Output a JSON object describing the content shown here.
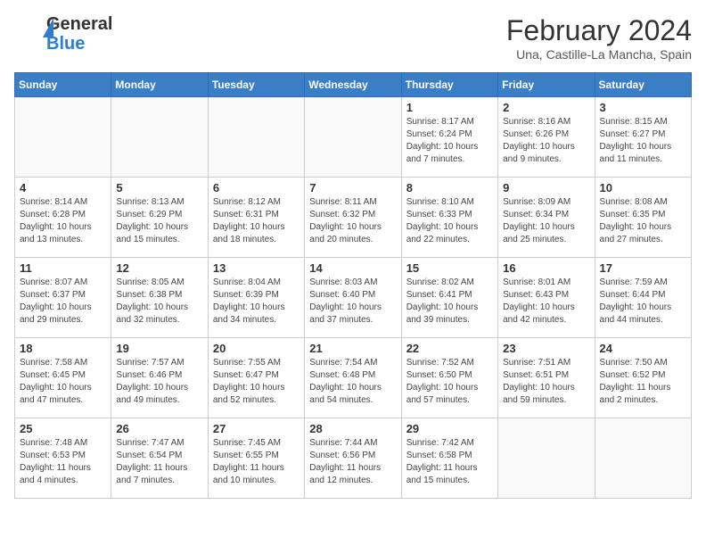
{
  "header": {
    "logo_general": "General",
    "logo_blue": "Blue",
    "month_year": "February 2024",
    "location": "Una, Castille-La Mancha, Spain"
  },
  "days_of_week": [
    "Sunday",
    "Monday",
    "Tuesday",
    "Wednesday",
    "Thursday",
    "Friday",
    "Saturday"
  ],
  "weeks": [
    [
      {
        "day": "",
        "info": ""
      },
      {
        "day": "",
        "info": ""
      },
      {
        "day": "",
        "info": ""
      },
      {
        "day": "",
        "info": ""
      },
      {
        "day": "1",
        "info": "Sunrise: 8:17 AM\nSunset: 6:24 PM\nDaylight: 10 hours\nand 7 minutes."
      },
      {
        "day": "2",
        "info": "Sunrise: 8:16 AM\nSunset: 6:26 PM\nDaylight: 10 hours\nand 9 minutes."
      },
      {
        "day": "3",
        "info": "Sunrise: 8:15 AM\nSunset: 6:27 PM\nDaylight: 10 hours\nand 11 minutes."
      }
    ],
    [
      {
        "day": "4",
        "info": "Sunrise: 8:14 AM\nSunset: 6:28 PM\nDaylight: 10 hours\nand 13 minutes."
      },
      {
        "day": "5",
        "info": "Sunrise: 8:13 AM\nSunset: 6:29 PM\nDaylight: 10 hours\nand 15 minutes."
      },
      {
        "day": "6",
        "info": "Sunrise: 8:12 AM\nSunset: 6:31 PM\nDaylight: 10 hours\nand 18 minutes."
      },
      {
        "day": "7",
        "info": "Sunrise: 8:11 AM\nSunset: 6:32 PM\nDaylight: 10 hours\nand 20 minutes."
      },
      {
        "day": "8",
        "info": "Sunrise: 8:10 AM\nSunset: 6:33 PM\nDaylight: 10 hours\nand 22 minutes."
      },
      {
        "day": "9",
        "info": "Sunrise: 8:09 AM\nSunset: 6:34 PM\nDaylight: 10 hours\nand 25 minutes."
      },
      {
        "day": "10",
        "info": "Sunrise: 8:08 AM\nSunset: 6:35 PM\nDaylight: 10 hours\nand 27 minutes."
      }
    ],
    [
      {
        "day": "11",
        "info": "Sunrise: 8:07 AM\nSunset: 6:37 PM\nDaylight: 10 hours\nand 29 minutes."
      },
      {
        "day": "12",
        "info": "Sunrise: 8:05 AM\nSunset: 6:38 PM\nDaylight: 10 hours\nand 32 minutes."
      },
      {
        "day": "13",
        "info": "Sunrise: 8:04 AM\nSunset: 6:39 PM\nDaylight: 10 hours\nand 34 minutes."
      },
      {
        "day": "14",
        "info": "Sunrise: 8:03 AM\nSunset: 6:40 PM\nDaylight: 10 hours\nand 37 minutes."
      },
      {
        "day": "15",
        "info": "Sunrise: 8:02 AM\nSunset: 6:41 PM\nDaylight: 10 hours\nand 39 minutes."
      },
      {
        "day": "16",
        "info": "Sunrise: 8:01 AM\nSunset: 6:43 PM\nDaylight: 10 hours\nand 42 minutes."
      },
      {
        "day": "17",
        "info": "Sunrise: 7:59 AM\nSunset: 6:44 PM\nDaylight: 10 hours\nand 44 minutes."
      }
    ],
    [
      {
        "day": "18",
        "info": "Sunrise: 7:58 AM\nSunset: 6:45 PM\nDaylight: 10 hours\nand 47 minutes."
      },
      {
        "day": "19",
        "info": "Sunrise: 7:57 AM\nSunset: 6:46 PM\nDaylight: 10 hours\nand 49 minutes."
      },
      {
        "day": "20",
        "info": "Sunrise: 7:55 AM\nSunset: 6:47 PM\nDaylight: 10 hours\nand 52 minutes."
      },
      {
        "day": "21",
        "info": "Sunrise: 7:54 AM\nSunset: 6:48 PM\nDaylight: 10 hours\nand 54 minutes."
      },
      {
        "day": "22",
        "info": "Sunrise: 7:52 AM\nSunset: 6:50 PM\nDaylight: 10 hours\nand 57 minutes."
      },
      {
        "day": "23",
        "info": "Sunrise: 7:51 AM\nSunset: 6:51 PM\nDaylight: 10 hours\nand 59 minutes."
      },
      {
        "day": "24",
        "info": "Sunrise: 7:50 AM\nSunset: 6:52 PM\nDaylight: 11 hours\nand 2 minutes."
      }
    ],
    [
      {
        "day": "25",
        "info": "Sunrise: 7:48 AM\nSunset: 6:53 PM\nDaylight: 11 hours\nand 4 minutes."
      },
      {
        "day": "26",
        "info": "Sunrise: 7:47 AM\nSunset: 6:54 PM\nDaylight: 11 hours\nand 7 minutes."
      },
      {
        "day": "27",
        "info": "Sunrise: 7:45 AM\nSunset: 6:55 PM\nDaylight: 11 hours\nand 10 minutes."
      },
      {
        "day": "28",
        "info": "Sunrise: 7:44 AM\nSunset: 6:56 PM\nDaylight: 11 hours\nand 12 minutes."
      },
      {
        "day": "29",
        "info": "Sunrise: 7:42 AM\nSunset: 6:58 PM\nDaylight: 11 hours\nand 15 minutes."
      },
      {
        "day": "",
        "info": ""
      },
      {
        "day": "",
        "info": ""
      }
    ]
  ]
}
